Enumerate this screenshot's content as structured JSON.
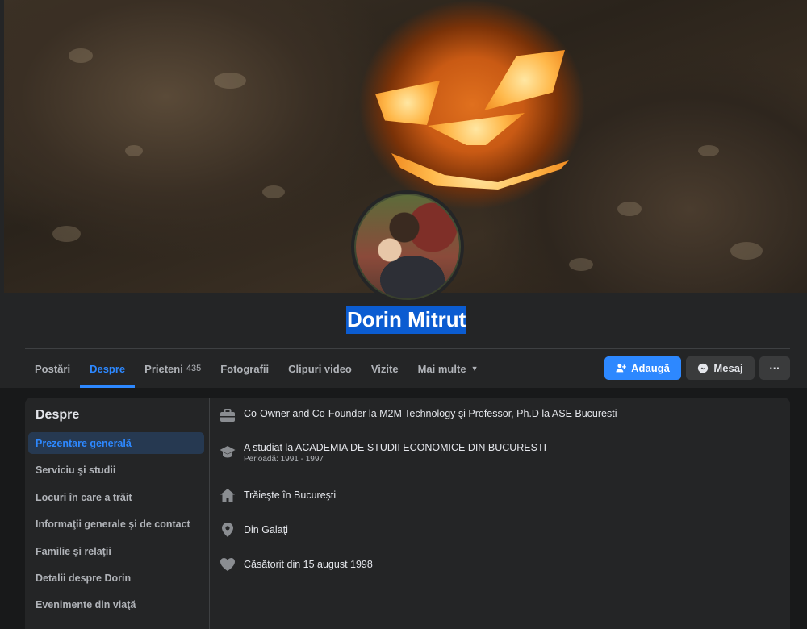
{
  "profile": {
    "name": "Dorin Mitrut"
  },
  "tabs": [
    {
      "label": "Postări"
    },
    {
      "label": "Despre",
      "active": true
    },
    {
      "label": "Prieteni",
      "count": "435"
    },
    {
      "label": "Fotografii"
    },
    {
      "label": "Clipuri video"
    },
    {
      "label": "Vizite"
    },
    {
      "label": "Mai multe"
    }
  ],
  "actions": {
    "add_label": "Adaugă",
    "message_label": "Mesaj",
    "more_label": "···"
  },
  "about": {
    "title": "Despre",
    "sidebar": [
      "Prezentare generală",
      "Serviciu şi studii",
      "Locuri în care a trăit",
      "Informaţii generale şi de contact",
      "Familie şi relaţii",
      "Detalii despre Dorin",
      "Evenimente din viaţă"
    ],
    "overview": {
      "work": "Co-Owner and Co-Founder la M2M Technology şi Professor, Ph.D la ASE Bucuresti",
      "education": "A studiat la ACADEMIA DE STUDII ECONOMICE DIN BUCURESTI",
      "education_period": "Perioadă: 1991 - 1997",
      "lives_in": "Trăieşte în Bucureşti",
      "from": "Din Galaţi",
      "relationship": "Căsătorit din 15 august 1998"
    }
  },
  "colors": {
    "accent": "#2d88ff",
    "background": "#18191a",
    "card": "#242526",
    "name_highlight": "#0b5cd1"
  },
  "icons": [
    "briefcase-icon",
    "graduation-cap-icon",
    "home-icon",
    "location-pin-icon",
    "heart-icon",
    "add-friend-icon",
    "messenger-icon",
    "caret-down-icon"
  ]
}
